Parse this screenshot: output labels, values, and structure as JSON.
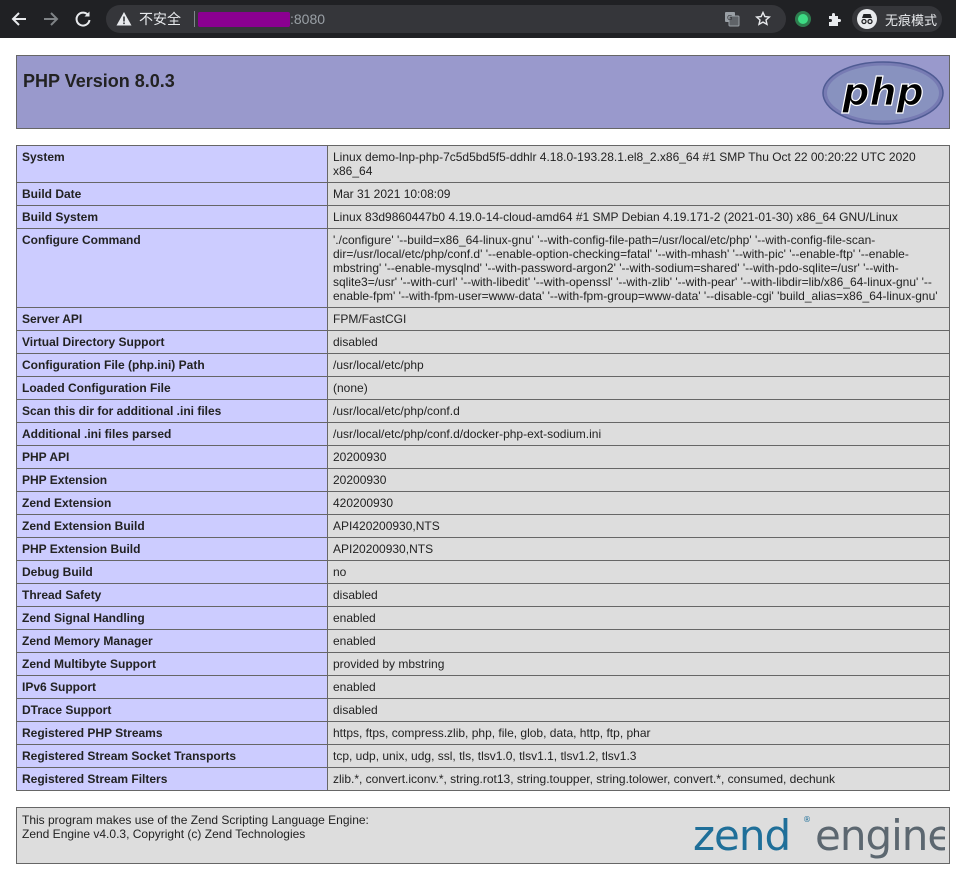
{
  "browser": {
    "security_label": "不安全",
    "url_port": ":8080",
    "incognito_label": "无痕模式"
  },
  "header": {
    "title": "PHP Version 8.0.3",
    "logo_text": "php"
  },
  "rows": [
    {
      "key": "System",
      "value": "Linux demo-lnp-php-7c5d5bd5f5-ddhlr 4.18.0-193.28.1.el8_2.x86_64 #1 SMP Thu Oct 22 00:20:22 UTC 2020 x86_64"
    },
    {
      "key": "Build Date",
      "value": "Mar 31 2021 10:08:09"
    },
    {
      "key": "Build System",
      "value": "Linux 83d9860447b0 4.19.0-14-cloud-amd64 #1 SMP Debian 4.19.171-2 (2021-01-30) x86_64 GNU/Linux"
    },
    {
      "key": "Configure Command",
      "value": "'./configure' '--build=x86_64-linux-gnu' '--with-config-file-path=/usr/local/etc/php' '--with-config-file-scan-dir=/usr/local/etc/php/conf.d' '--enable-option-checking=fatal' '--with-mhash' '--with-pic' '--enable-ftp' '--enable-mbstring' '--enable-mysqlnd' '--with-password-argon2' '--with-sodium=shared' '--with-pdo-sqlite=/usr' '--with-sqlite3=/usr' '--with-curl' '--with-libedit' '--with-openssl' '--with-zlib' '--with-pear' '--with-libdir=lib/x86_64-linux-gnu' '--enable-fpm' '--with-fpm-user=www-data' '--with-fpm-group=www-data' '--disable-cgi' 'build_alias=x86_64-linux-gnu'"
    },
    {
      "key": "Server API",
      "value": "FPM/FastCGI"
    },
    {
      "key": "Virtual Directory Support",
      "value": "disabled"
    },
    {
      "key": "Configuration File (php.ini) Path",
      "value": "/usr/local/etc/php"
    },
    {
      "key": "Loaded Configuration File",
      "value": "(none)"
    },
    {
      "key": "Scan this dir for additional .ini files",
      "value": "/usr/local/etc/php/conf.d"
    },
    {
      "key": "Additional .ini files parsed",
      "value": "/usr/local/etc/php/conf.d/docker-php-ext-sodium.ini"
    },
    {
      "key": "PHP API",
      "value": "20200930"
    },
    {
      "key": "PHP Extension",
      "value": "20200930"
    },
    {
      "key": "Zend Extension",
      "value": "420200930"
    },
    {
      "key": "Zend Extension Build",
      "value": "API420200930,NTS"
    },
    {
      "key": "PHP Extension Build",
      "value": "API20200930,NTS"
    },
    {
      "key": "Debug Build",
      "value": "no"
    },
    {
      "key": "Thread Safety",
      "value": "disabled"
    },
    {
      "key": "Zend Signal Handling",
      "value": "enabled"
    },
    {
      "key": "Zend Memory Manager",
      "value": "enabled"
    },
    {
      "key": "Zend Multibyte Support",
      "value": "provided by mbstring"
    },
    {
      "key": "IPv6 Support",
      "value": "enabled"
    },
    {
      "key": "DTrace Support",
      "value": "disabled"
    },
    {
      "key": "Registered PHP Streams",
      "value": "https, ftps, compress.zlib, php, file, glob, data, http, ftp, phar"
    },
    {
      "key": "Registered Stream Socket Transports",
      "value": "tcp, udp, unix, udg, ssl, tls, tlsv1.0, tlsv1.1, tlsv1.2, tlsv1.3"
    },
    {
      "key": "Registered Stream Filters",
      "value": "zlib.*, convert.iconv.*, string.rot13, string.toupper, string.tolower, convert.*, consumed, dechunk"
    }
  ],
  "footer": {
    "line1": "This program makes use of the Zend Scripting Language Engine:",
    "line2": "Zend Engine v4.0.3, Copyright (c) Zend Technologies",
    "logo_word1": "zend",
    "logo_word2": "engine"
  },
  "colors": {
    "header_bg": "#9999cc",
    "key_cell_bg": "#ccccff",
    "value_cell_bg": "#dddddd",
    "zend_logo_blue": "#1f6f99",
    "zend_logo_gray": "#5c6770",
    "chrome_bg": "#202124"
  }
}
